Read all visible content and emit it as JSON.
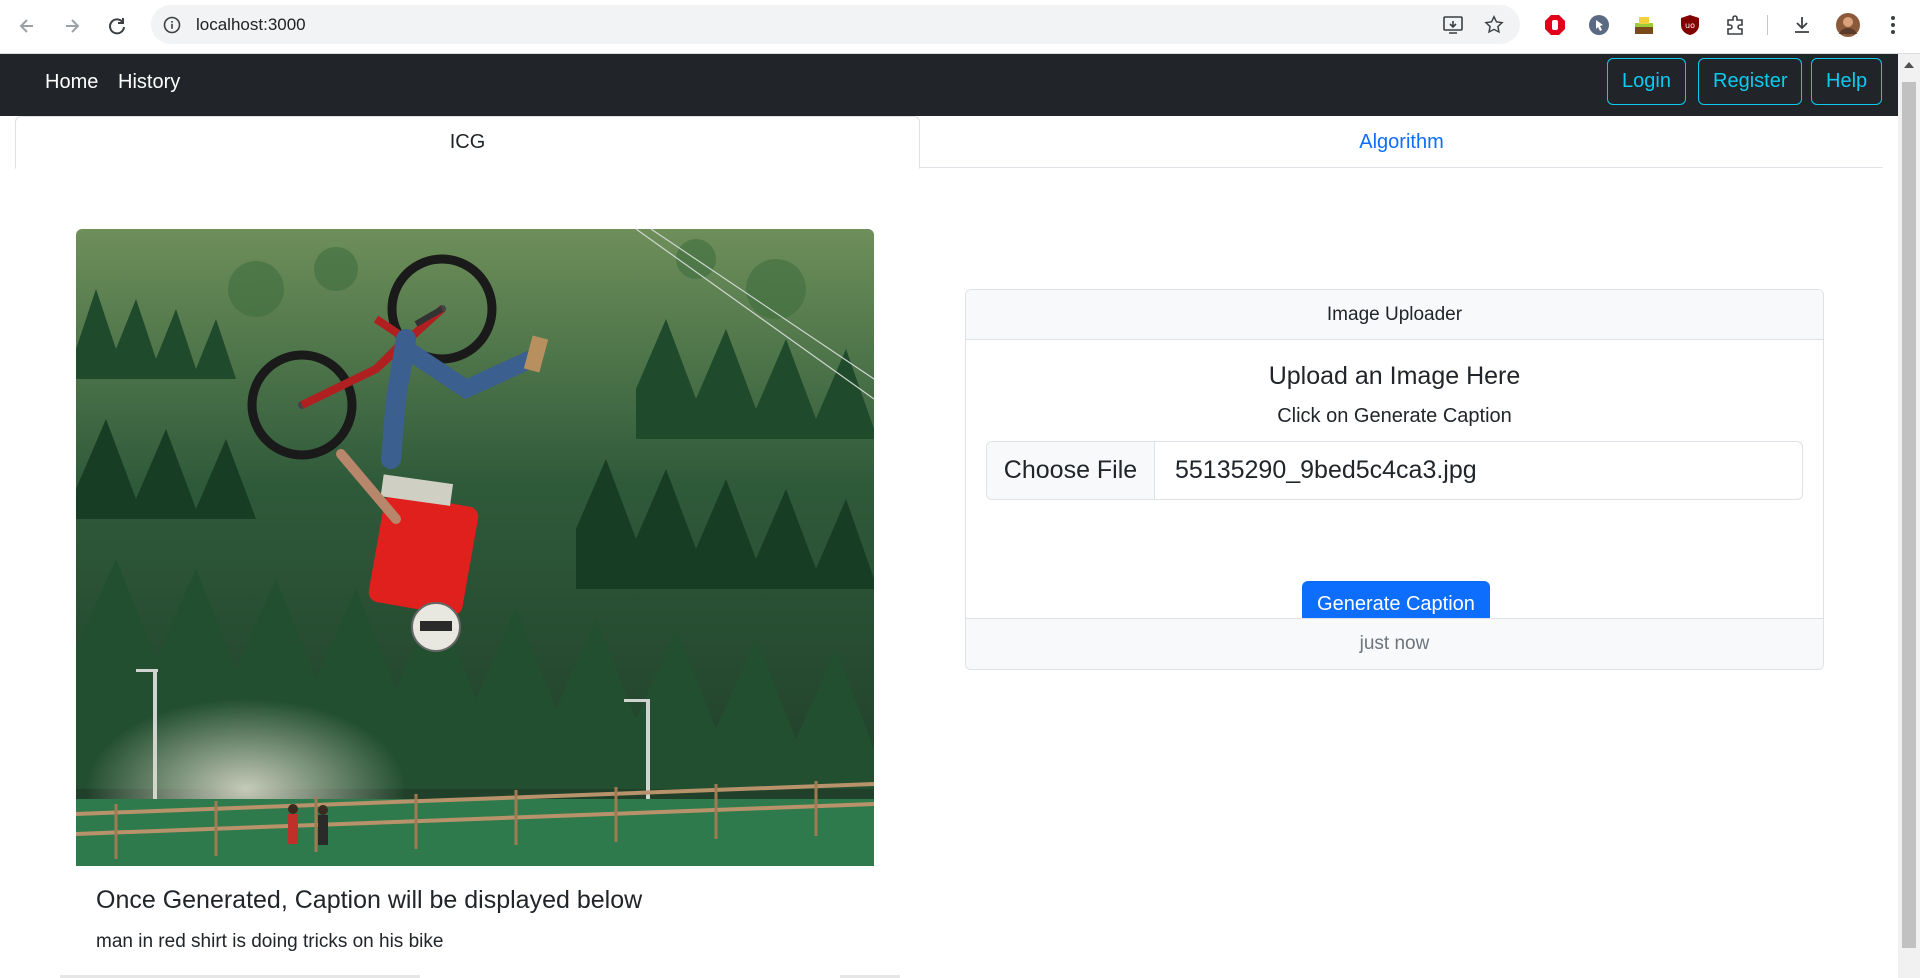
{
  "browser": {
    "url": "localhost:3000"
  },
  "navbar": {
    "home": "Home",
    "history": "History",
    "login": "Login",
    "register": "Register",
    "help": "Help"
  },
  "tabs": [
    {
      "label": "ICG",
      "active": true
    },
    {
      "label": "Algorithm",
      "active": false
    }
  ],
  "caption_section": {
    "title": "Once Generated, Caption will be displayed below",
    "caption": "man in red shirt is doing tricks on his bike"
  },
  "uploader": {
    "header": "Image Uploader",
    "title": "Upload an Image Here",
    "subtitle": "Click on Generate Caption",
    "choose_file_label": "Choose File",
    "file_name": "55135290_9bed5c4ca3.jpg",
    "generate_button": "Generate Caption",
    "footer": "just now"
  },
  "colors": {
    "navbar_bg": "#212529",
    "outline_accent": "#0dcaf0",
    "primary": "#0d6efd"
  },
  "icons": [
    "back-arrow-icon",
    "forward-arrow-icon",
    "reload-icon",
    "site-info-icon",
    "install-app-icon",
    "bookmark-star-icon",
    "extensions-icon",
    "download-icon",
    "kebab-menu-icon"
  ]
}
